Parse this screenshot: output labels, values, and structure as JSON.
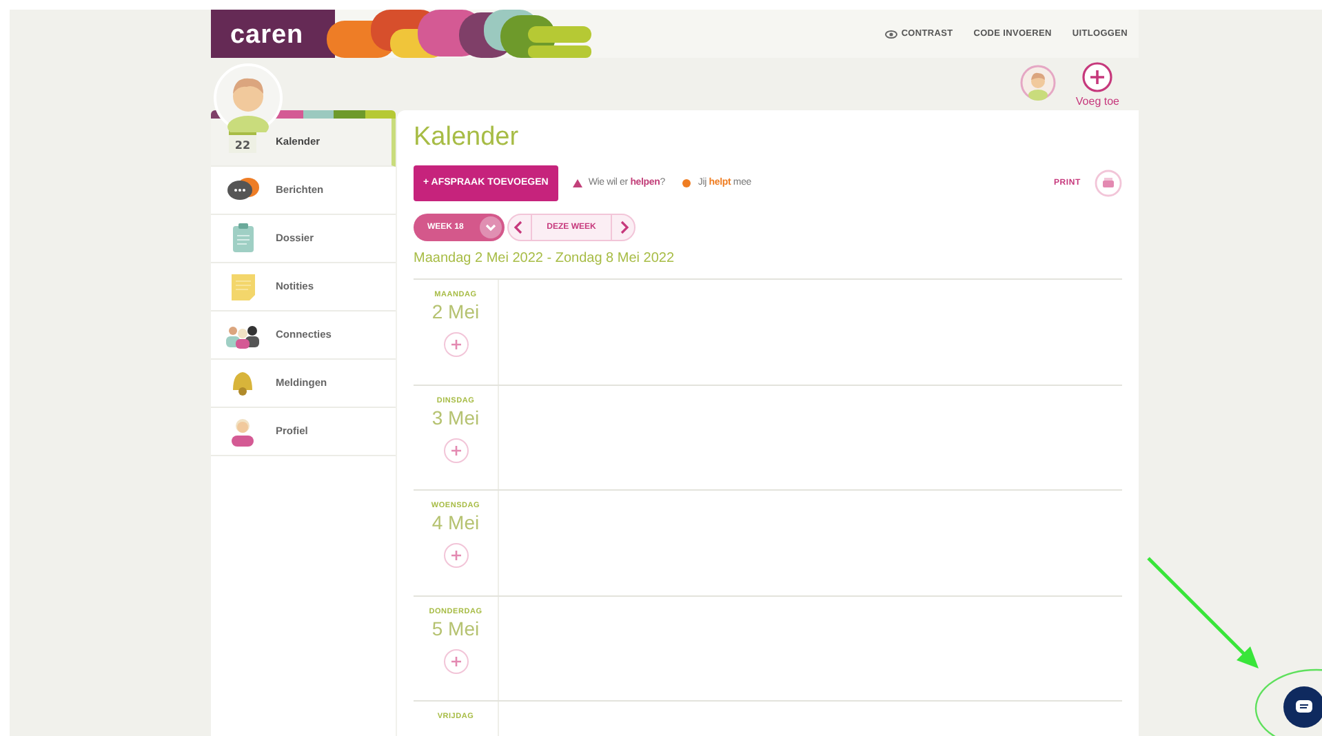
{
  "header": {
    "logo": "caren",
    "links": [
      {
        "label": "CONTRAST",
        "kind": "icon"
      },
      {
        "label": "CODE INVOEREN",
        "kind": "plain"
      },
      {
        "label": "UITLOGGEN",
        "kind": "plain"
      }
    ]
  },
  "profiles": {
    "add_label": "Voeg toe"
  },
  "sidebar": {
    "items": [
      {
        "label": "Kalender",
        "kind": "calendar",
        "badge": "22",
        "selected": true
      },
      {
        "label": "Berichten",
        "kind": "chat",
        "selected": false
      },
      {
        "label": "Dossier",
        "kind": "clipboard",
        "selected": false
      },
      {
        "label": "Notities",
        "kind": "note",
        "selected": false
      },
      {
        "label": "Connecties",
        "kind": "people",
        "selected": false
      },
      {
        "label": "Meldingen",
        "kind": "bell",
        "selected": false
      },
      {
        "label": "Profiel",
        "kind": "person",
        "selected": false
      }
    ]
  },
  "main": {
    "title": "Kalender",
    "add_button": "+ AFSPRAAK TOEVOEGEN",
    "legend": [
      {
        "kind": "triangle",
        "color": "#c2407a",
        "text": "Wie wil er **helpen**?"
      },
      {
        "kind": "dot",
        "color": "#ef7d22",
        "text": "Jij **helpt** mee"
      }
    ],
    "print": "PRINT",
    "week": "WEEK 18",
    "this_week": "DEZE WEEK",
    "range": "Maandag 2 Mei 2022 - Zondag 8 Mei 2022",
    "days": [
      {
        "weekday": "MAANDAG",
        "date": "2 Mei"
      },
      {
        "weekday": "DINSDAG",
        "date": "3 Mei"
      },
      {
        "weekday": "WOENSDAG",
        "date": "4 Mei"
      },
      {
        "weekday": "DONDERDAG",
        "date": "5 Mei"
      },
      {
        "weekday": "VRIJDAG"
      }
    ]
  }
}
